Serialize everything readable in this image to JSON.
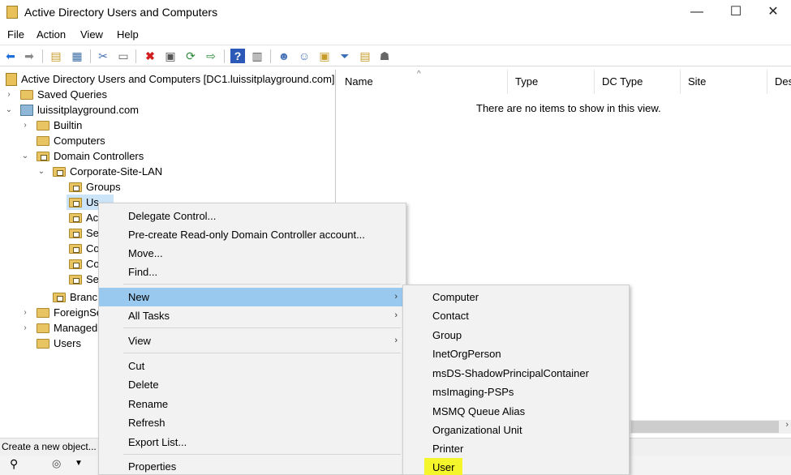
{
  "window": {
    "title": "Active Directory Users and Computers",
    "minimize_icon": "—",
    "maximize_icon": "☐",
    "close_icon": "✕"
  },
  "menu": [
    "File",
    "Action",
    "View",
    "Help"
  ],
  "tree": {
    "root": "Active Directory Users and Computers [DC1.luissitplayground.com]",
    "saved_queries": "Saved Queries",
    "domain": "luissitplayground.com",
    "builtin": "Builtin",
    "computers": "Computers",
    "domain_controllers": "Domain Controllers",
    "site_ou": "Corporate-Site-LAN",
    "groups": "Groups",
    "users_partial": "Us",
    "ac_partial": "Ac",
    "se_partial": "Se",
    "co_partial": "Co",
    "co2_partial": "Co",
    "se2_partial": "Se",
    "branch_partial": "Branc",
    "foreign_partial": "ForeignSe",
    "managed_partial": "Managed",
    "users": "Users"
  },
  "list": {
    "columns": [
      "Name",
      "Type",
      "DC Type",
      "Site",
      "Desc"
    ],
    "empty_message": "There are no items to show in this view."
  },
  "status": {
    "text": "Create a new object..."
  },
  "context_menu": {
    "items": [
      {
        "label": "Delegate Control..."
      },
      {
        "label": "Pre-create Read-only Domain Controller account..."
      },
      {
        "label": "Move..."
      },
      {
        "label": "Find..."
      },
      {
        "label": "New",
        "arrow": "›"
      },
      {
        "label": "All Tasks",
        "arrow": "›"
      },
      {
        "label": "View",
        "arrow": "›"
      },
      {
        "label": "Cut"
      },
      {
        "label": "Delete"
      },
      {
        "label": "Rename"
      },
      {
        "label": "Refresh"
      },
      {
        "label": "Export List..."
      },
      {
        "label": "Properties"
      }
    ]
  },
  "new_submenu": {
    "items": [
      "Computer",
      "Contact",
      "Group",
      "InetOrgPerson",
      "msDS-ShadowPrincipalContainer",
      "msImaging-PSPs",
      "MSMQ Queue Alias",
      "Organizational Unit",
      "Printer",
      "User"
    ]
  },
  "colors": {
    "menu_highlight": "#99c9ef",
    "user_highlight": "#f5f52b",
    "folder": "#e9c463"
  }
}
